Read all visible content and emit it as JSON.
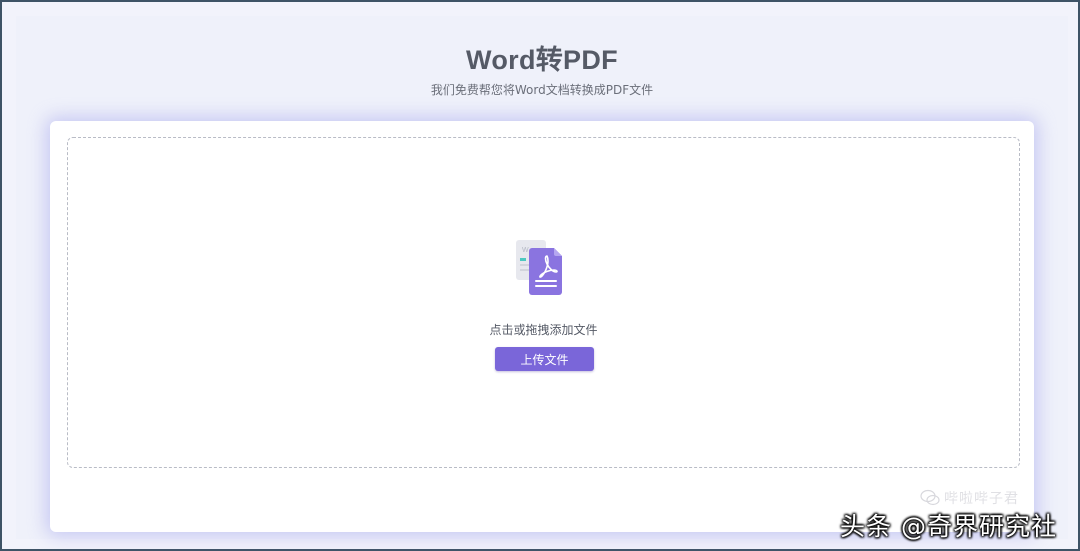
{
  "page": {
    "title": "Word转PDF",
    "subtitle": "我们免费帮您将Word文档转换成PDF文件"
  },
  "dropzone": {
    "hint": "点击或拖拽添加文件",
    "upload_label": "上传文件",
    "icon": "word-to-pdf-icon"
  },
  "watermarks": {
    "wechat": "哔啦哔子君",
    "toutiao": "头条 @奇界研究社"
  },
  "colors": {
    "accent": "#7a66d9",
    "background": "#eff1fa",
    "card": "#ffffff",
    "title_text": "#555a66"
  }
}
